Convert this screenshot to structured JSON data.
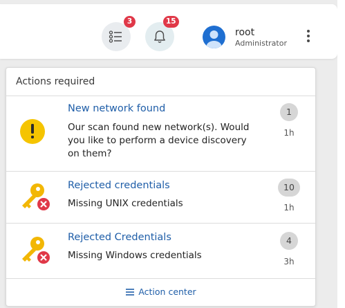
{
  "header": {
    "tasks_badge": "3",
    "notifications_badge": "15",
    "user": {
      "name": "root",
      "role": "Administrator"
    }
  },
  "actions_panel": {
    "title": "Actions required",
    "items": [
      {
        "title": "New network found",
        "description": "Our scan found new network(s). Would you like to perform a device discovery on them?",
        "count": "1",
        "time": "1h",
        "icon": "warning-icon"
      },
      {
        "title": "Rejected credentials",
        "description": "Missing UNIX credentials",
        "count": "10",
        "time": "1h",
        "icon": "rejected-key-icon"
      },
      {
        "title": "Rejected Credentials",
        "description": "Missing Windows credentials",
        "count": "4",
        "time": "3h",
        "icon": "rejected-key-icon"
      }
    ],
    "footer_link": "Action center"
  },
  "colors": {
    "accent": "#1f5ea8",
    "badge": "#e03848",
    "warning": "#f5c400",
    "key": "#f2b705",
    "error": "#e03848"
  }
}
